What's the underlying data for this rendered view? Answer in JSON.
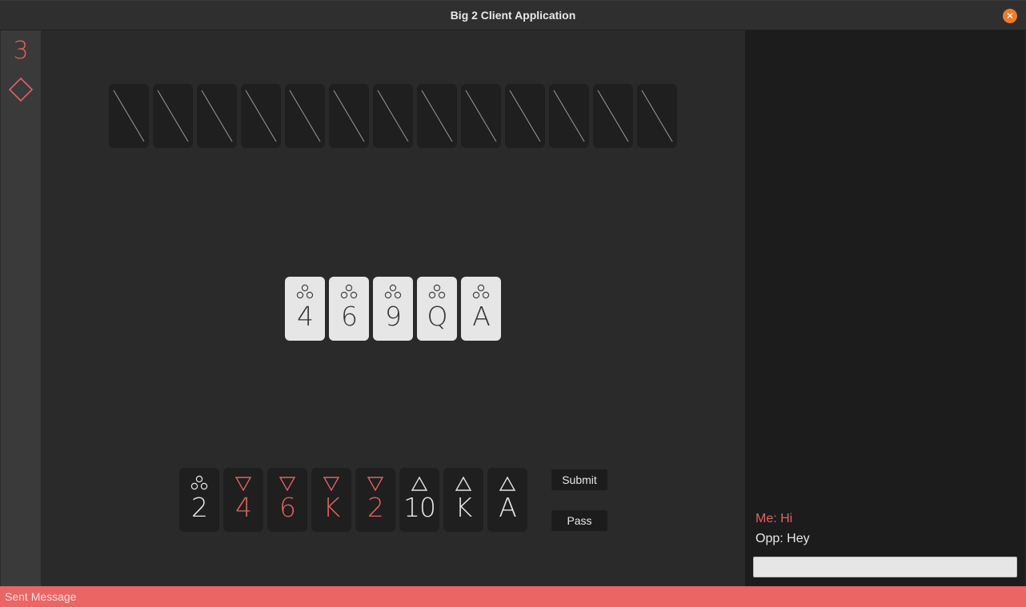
{
  "window": {
    "title": "Big 2 Client Application",
    "close_icon": "close-icon"
  },
  "sidebar": {
    "turn_count": "3",
    "turn_suit": "diamond"
  },
  "opponent_hand": {
    "card_count": 13
  },
  "played_cards": [
    {
      "rank": "4",
      "suit": "clubs"
    },
    {
      "rank": "6",
      "suit": "clubs"
    },
    {
      "rank": "9",
      "suit": "clubs"
    },
    {
      "rank": "Q",
      "suit": "clubs"
    },
    {
      "rank": "A",
      "suit": "clubs"
    }
  ],
  "player_hand": [
    {
      "rank": "2",
      "suit": "clubs"
    },
    {
      "rank": "4",
      "suit": "hearts"
    },
    {
      "rank": "6",
      "suit": "hearts"
    },
    {
      "rank": "K",
      "suit": "hearts"
    },
    {
      "rank": "2",
      "suit": "hearts"
    },
    {
      "rank": "10",
      "suit": "spades"
    },
    {
      "rank": "K",
      "suit": "spades"
    },
    {
      "rank": "A",
      "suit": "spades"
    }
  ],
  "actions": {
    "submit_label": "Submit",
    "pass_label": "Pass"
  },
  "chat": {
    "messages": [
      {
        "sender": "me",
        "text": "Me: Hi"
      },
      {
        "sender": "opponent",
        "text": "Opp: Hey"
      }
    ],
    "input_value": ""
  },
  "status": {
    "text": "Sent Message"
  },
  "colors": {
    "accent_red": "#e06262",
    "status_bar": "#eb6565",
    "close_orange": "#f07b2a"
  }
}
